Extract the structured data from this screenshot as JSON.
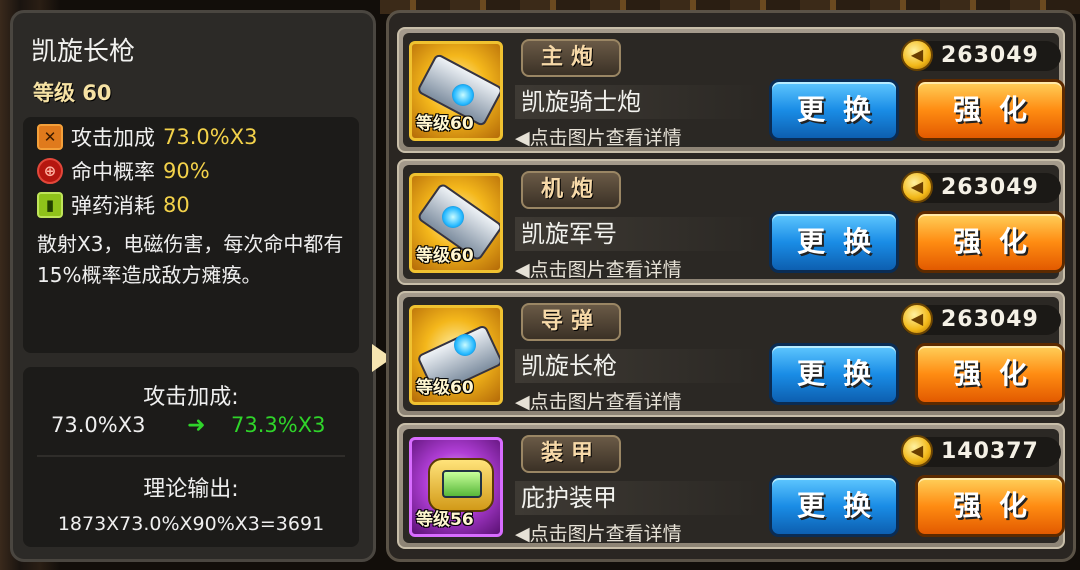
{
  "detail": {
    "weapon_name": "凯旋长枪",
    "level": "等级 60",
    "stats": [
      {
        "icon": "crossed-swords-icon",
        "label": "攻击加成",
        "value": "73.0%X3"
      },
      {
        "icon": "crosshair-icon",
        "label": "命中概率",
        "value": "90%"
      },
      {
        "icon": "ammo-icon",
        "label": "弹药消耗",
        "value": "80"
      }
    ],
    "description": "散射X3，电磁伤害，每次命中都有15%概率造成敌方瘫痪。",
    "compare_title": "攻击加成:",
    "compare_old": "73.0%X3",
    "compare_arrow": "➜",
    "compare_new": "73.3%X3",
    "output_title": "理论输出:",
    "output_formula": "1873X73.0%X90%X3=3691"
  },
  "slots": [
    {
      "type": "主炮",
      "name": "凯旋骑士炮",
      "level": "等级60",
      "hint": "◀点击图片查看详情",
      "cost": "263049",
      "icon": "cannon-icon",
      "rarity": "gold",
      "change_label": "更换",
      "upgrade_label": "强化"
    },
    {
      "type": "机炮",
      "name": "凯旋军号",
      "level": "等级60",
      "hint": "◀点击图片查看详情",
      "cost": "263049",
      "icon": "machine-gun-icon",
      "rarity": "gold",
      "change_label": "更换",
      "upgrade_label": "强化"
    },
    {
      "type": "导弹",
      "name": "凯旋长枪",
      "level": "等级60",
      "hint": "◀点击图片查看详情",
      "cost": "263049",
      "icon": "missile-launcher-icon",
      "rarity": "gold",
      "change_label": "更换",
      "upgrade_label": "强化"
    },
    {
      "type": "装甲",
      "name": "庇护装甲",
      "level": "等级56",
      "hint": "◀点击图片查看详情",
      "cost": "140377",
      "icon": "armor-icon",
      "rarity": "purple",
      "change_label": "更换",
      "upgrade_label": "强化"
    }
  ],
  "colors": {
    "stat_value": "#f3d24a",
    "upgrade_value": "#2fd42a",
    "change_button": "#1a8de6",
    "upgrade_button": "#ff8c12"
  }
}
